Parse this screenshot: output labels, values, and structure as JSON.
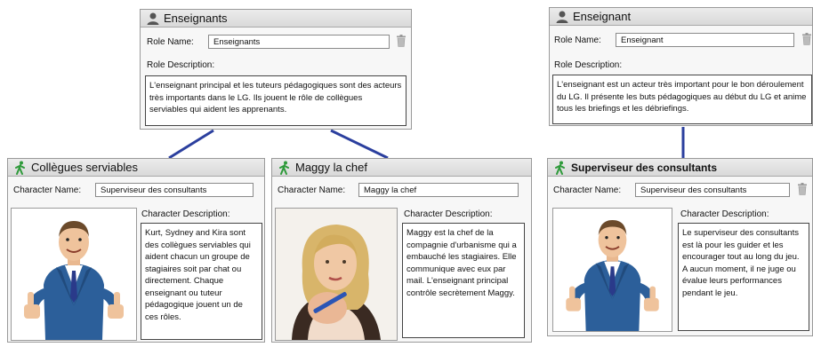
{
  "roles": [
    {
      "title": "Enseignants",
      "role_name_label": "Role Name:",
      "role_name_value": "Enseignants",
      "role_desc_label": "Role Description:",
      "role_desc": "L'enseignant principal et les tuteurs pédagogiques sont des acteurs très importants dans le LG. Ils jouent le rôle de collègues serviables qui aident les apprenants.",
      "icon": "person-icon"
    },
    {
      "title": "Enseignant",
      "role_name_label": "Role Name:",
      "role_name_value": "Enseignant",
      "role_desc_label": "Role Description:",
      "role_desc": "L'enseignant est un acteur très important pour le bon déroulement du LG. Il présente les buts pédagogiques au début du LG et anime tous les briefings et les débriefings.",
      "icon": "person-icon"
    }
  ],
  "characters": [
    {
      "title": "Collègues serviables",
      "char_name_label": "Character Name:",
      "char_name_value": "Superviseur des consultants",
      "char_desc_label": "Character Description:",
      "char_desc": "Kurt, Sydney and Kira sont des collègues serviables qui aident chacun un groupe de stagiaires soit par chat ou directement. Chaque enseignant ou tuteur  pédagogique jouent un de ces rôles.",
      "icon": "walking-figure-icon"
    },
    {
      "title": "Maggy la chef",
      "char_name_label": "Character Name:",
      "char_name_value": "Maggy la chef",
      "char_desc_label": "Character Description:",
      "char_desc": "Maggy est la chef de la compagnie d'urbanisme qui a embauché les stagiaires. Elle communique avec eux par mail. L'enseignant principal contrôle secrètement Maggy.",
      "icon": "walking-figure-icon"
    },
    {
      "title": "Superviseur des consultants",
      "char_name_label": "Character Name:",
      "char_name_value": "Superviseur des consultants",
      "char_desc_label": "Character Description:",
      "char_desc": "Le superviseur des consultants est là pour les guider et les encourager tout au long du jeu. A aucun moment, il ne juge ou évalue leurs performances pendant le jeu.",
      "icon": "walking-figure-icon"
    }
  ],
  "colors": {
    "connector": "#2b3f9e",
    "header": "#dcdcdc",
    "icon_green": "#2e9a3a"
  }
}
